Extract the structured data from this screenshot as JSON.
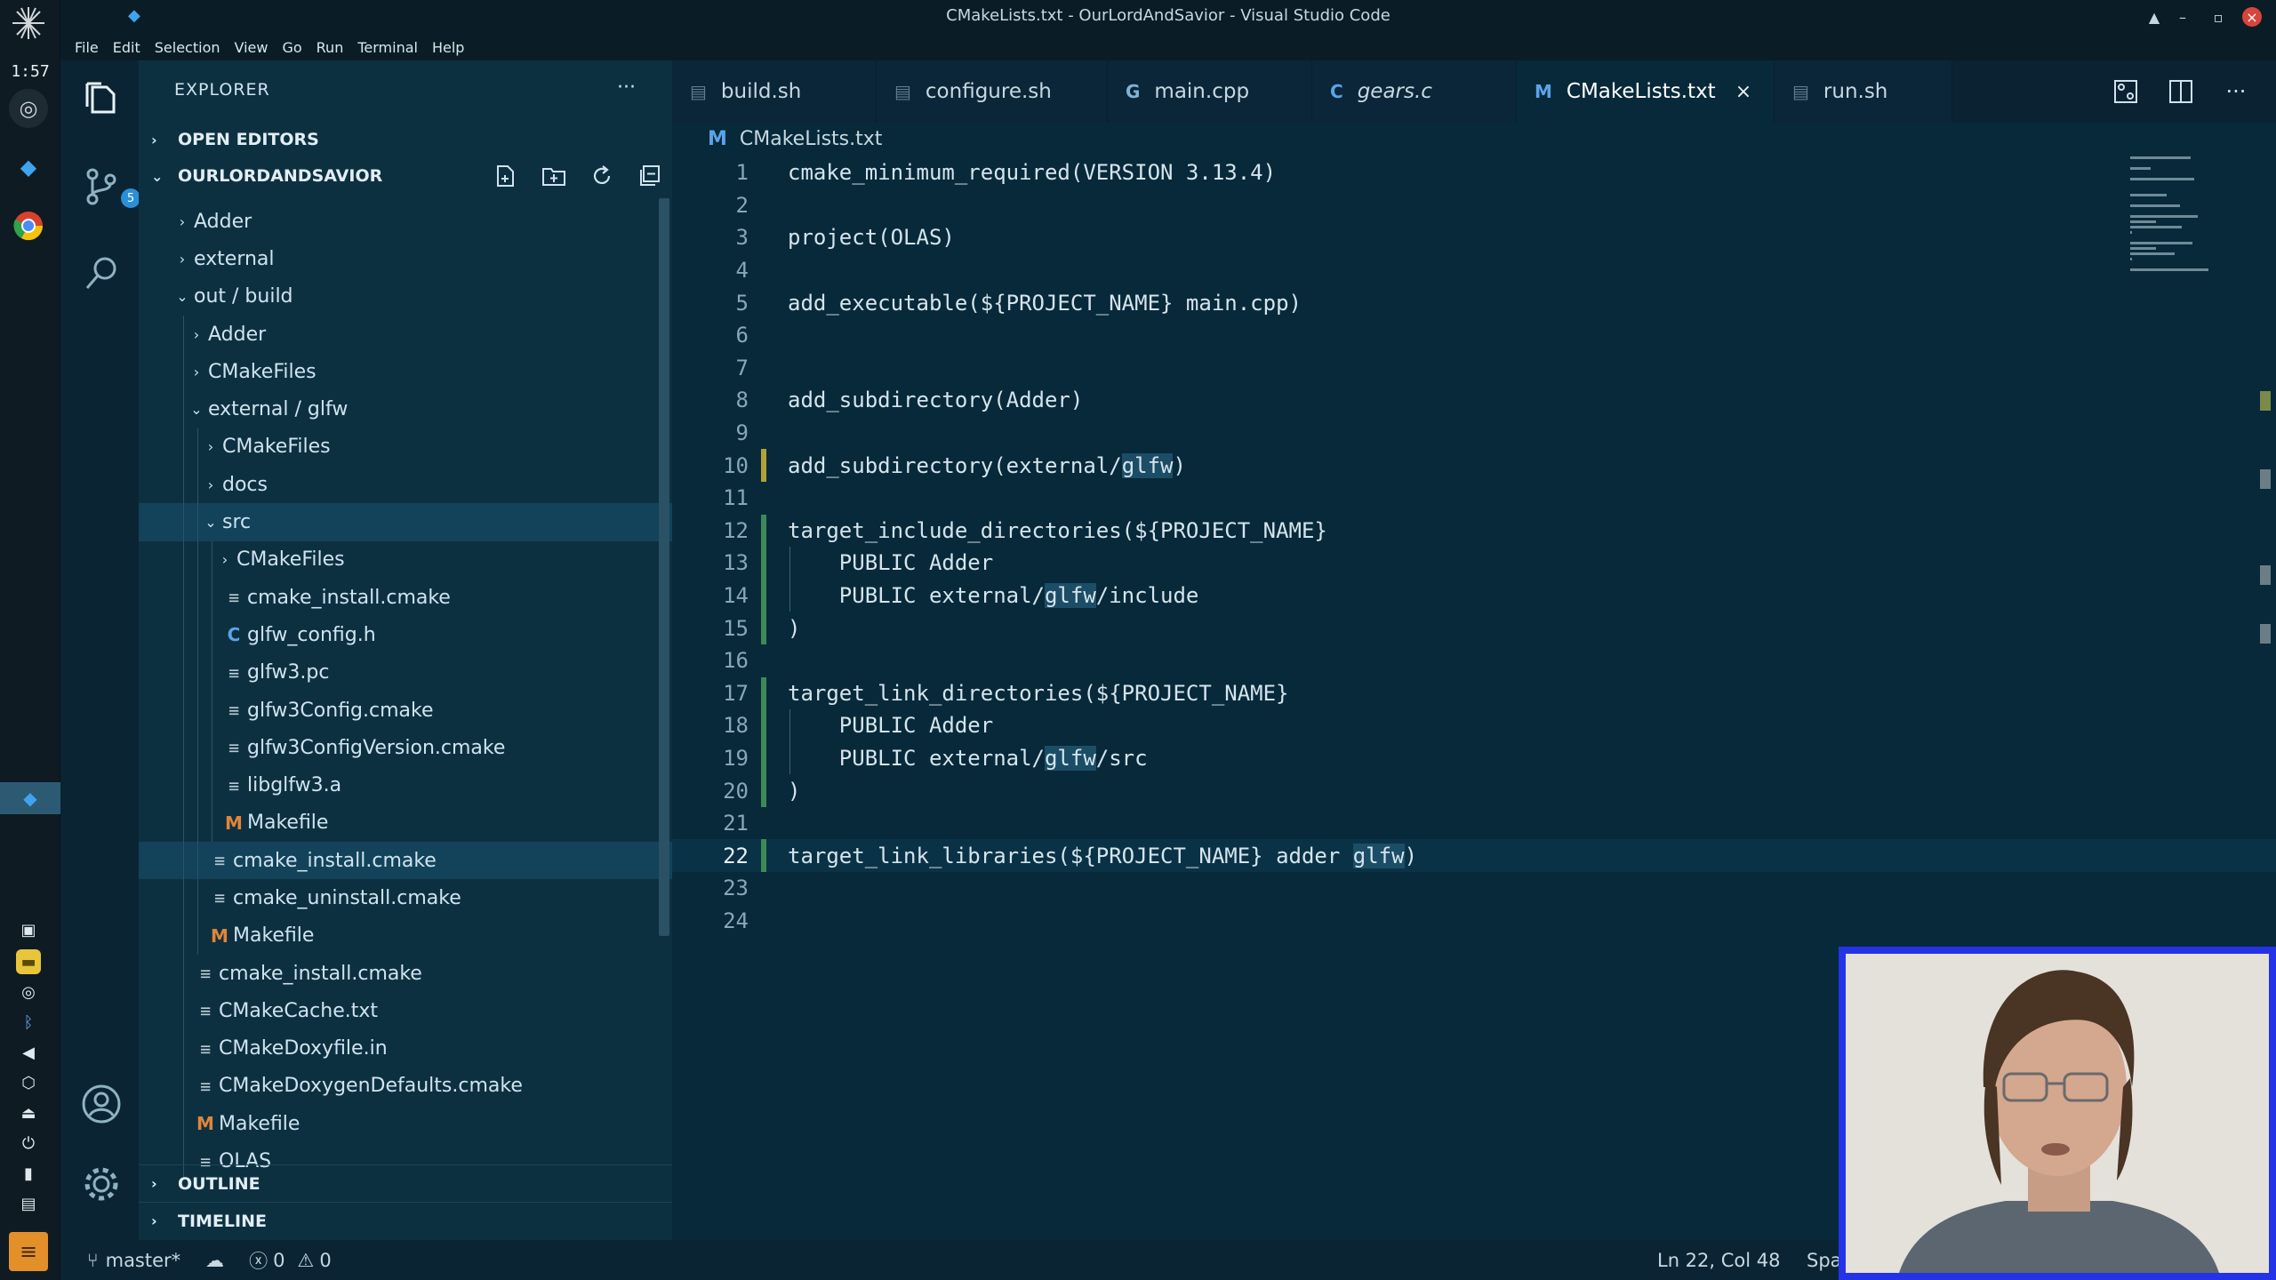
{
  "window": {
    "title": "CMakeLists.txt - OurLordAndSavior - Visual Studio Code"
  },
  "os": {
    "clock": "1:57"
  },
  "menu": [
    "File",
    "Edit",
    "Selection",
    "View",
    "Go",
    "Run",
    "Terminal",
    "Help"
  ],
  "activity": {
    "scm_badge": "5"
  },
  "explorer": {
    "title": "EXPLORER",
    "more": "···",
    "open_editors": "OPEN EDITORS",
    "workspace": "OURLORDANDSAVIOR",
    "outline": "OUTLINE",
    "timeline": "TIMELINE"
  },
  "tree": [
    {
      "label": "Adder",
      "indent": 0,
      "type": "folder",
      "open": false
    },
    {
      "label": "external",
      "indent": 0,
      "type": "folder",
      "open": false
    },
    {
      "label": "out / build",
      "indent": 0,
      "type": "folder",
      "open": true
    },
    {
      "label": "Adder",
      "indent": 1,
      "type": "folder",
      "open": false
    },
    {
      "label": "CMakeFiles",
      "indent": 1,
      "type": "folder",
      "open": false
    },
    {
      "label": "external / glfw",
      "indent": 1,
      "type": "folder",
      "open": true
    },
    {
      "label": "CMakeFiles",
      "indent": 2,
      "type": "folder",
      "open": false
    },
    {
      "label": "docs",
      "indent": 2,
      "type": "folder",
      "open": false
    },
    {
      "label": "src",
      "indent": 2,
      "type": "folder",
      "open": true,
      "selected": true
    },
    {
      "label": "CMakeFiles",
      "indent": 3,
      "type": "folder",
      "open": false
    },
    {
      "label": "cmake_install.cmake",
      "indent": 3,
      "type": "lines"
    },
    {
      "label": "glfw_config.h",
      "indent": 3,
      "type": "c"
    },
    {
      "label": "glfw3.pc",
      "indent": 3,
      "type": "lines"
    },
    {
      "label": "glfw3Config.cmake",
      "indent": 3,
      "type": "lines"
    },
    {
      "label": "glfw3ConfigVersion.cmake",
      "indent": 3,
      "type": "lines"
    },
    {
      "label": "libglfw3.a",
      "indent": 3,
      "type": "lines"
    },
    {
      "label": "Makefile",
      "indent": 3,
      "type": "m"
    },
    {
      "label": "cmake_install.cmake",
      "indent": 2,
      "type": "lines",
      "selected": true
    },
    {
      "label": "cmake_uninstall.cmake",
      "indent": 2,
      "type": "lines"
    },
    {
      "label": "Makefile",
      "indent": 2,
      "type": "m"
    },
    {
      "label": "cmake_install.cmake",
      "indent": 1,
      "type": "lines"
    },
    {
      "label": "CMakeCache.txt",
      "indent": 1,
      "type": "lines"
    },
    {
      "label": "CMakeDoxyfile.in",
      "indent": 1,
      "type": "lines"
    },
    {
      "label": "CMakeDoxygenDefaults.cmake",
      "indent": 1,
      "type": "lines"
    },
    {
      "label": "Makefile",
      "indent": 1,
      "type": "m"
    },
    {
      "label": "OLAS",
      "indent": 1,
      "type": "lines"
    }
  ],
  "tabs": [
    {
      "label": "build.sh",
      "icon": "file",
      "active": false
    },
    {
      "label": "configure.sh",
      "icon": "file",
      "active": false
    },
    {
      "label": "main.cpp",
      "icon": "cpp",
      "active": false
    },
    {
      "label": "gears.c",
      "icon": "c",
      "active": false,
      "italic": true
    },
    {
      "label": "CMakeLists.txt",
      "icon": "m",
      "active": true
    },
    {
      "label": "run.sh",
      "icon": "file",
      "active": false
    }
  ],
  "breadcrumb": "CMakeLists.txt",
  "code": [
    "cmake_minimum_required(VERSION 3.13.4)",
    "",
    "project(OLAS)",
    "",
    "add_executable(${PROJECT_NAME} main.cpp)",
    "",
    "",
    "add_subdirectory(Adder)",
    "",
    "add_subdirectory(external/glfw)",
    "",
    "target_include_directories(${PROJECT_NAME}",
    "    PUBLIC Adder",
    "    PUBLIC external/glfw/include",
    ")",
    "",
    "target_link_directories(${PROJECT_NAME}",
    "    PUBLIC Adder",
    "    PUBLIC external/glfw/src",
    ")",
    "",
    "target_link_libraries(${PROJECT_NAME} adder glfw)",
    "",
    ""
  ],
  "editor": {
    "current_line": 22
  },
  "status": {
    "branch": "master*",
    "errors": "0",
    "warnings": "0",
    "position": "Ln 22, Col 48",
    "spaces": "Spa"
  },
  "colors": {
    "accent": "#2b8fd8",
    "webcam_border": "#2432e8"
  }
}
